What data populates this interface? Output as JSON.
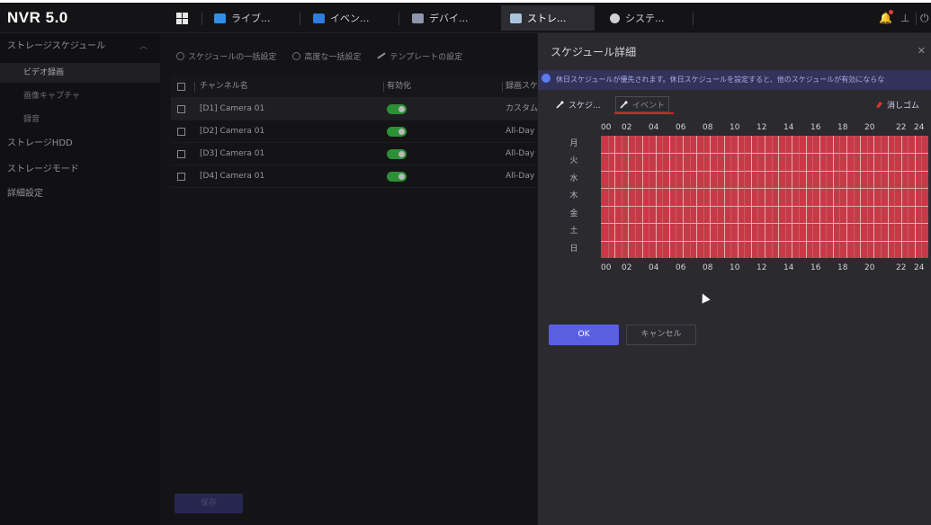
{
  "header": {
    "logo": "NVR 5.0",
    "tabs": [
      {
        "label": "ライブ...",
        "icon": "camera-icon"
      },
      {
        "label": "イベン...",
        "icon": "event-icon"
      },
      {
        "label": "デバイ...",
        "icon": "device-icon"
      },
      {
        "label": "ストレ...",
        "icon": "storage-icon"
      },
      {
        "label": "システ...",
        "icon": "system-gear-icon"
      }
    ],
    "active_tab": "ストレ...",
    "right_icons": [
      "notification-bell-icon",
      "export-icon",
      "power-icon"
    ]
  },
  "sidebar": {
    "section": "ストレージスケジュール",
    "items": [
      {
        "label": "ビデオ録画",
        "active": true
      },
      {
        "label": "画像キャプチャ"
      },
      {
        "label": "録音"
      }
    ],
    "groups": [
      "ストレージHDD",
      "ストレージモード",
      "詳細設定"
    ]
  },
  "toolbar": {
    "batch": "スケジュールの一括設定",
    "advanced_batch": "高度な一括設定",
    "template": "テンプレートの設定"
  },
  "table": {
    "headers": [
      "チャンネル名",
      "有効化",
      "録画スケ"
    ],
    "rows": [
      {
        "name": "[D1] Camera 01",
        "schedule": "カスタム"
      },
      {
        "name": "[D2] Camera 01",
        "schedule": "All-Day"
      },
      {
        "name": "[D3] Camera 01",
        "schedule": "All-Day"
      },
      {
        "name": "[D4] Camera 01",
        "schedule": "All-Day"
      }
    ]
  },
  "save_label": "保存",
  "panel": {
    "title": "スケジュール詳細",
    "notice": "休日スケジュールが優先されます。休日スケジュールを設定すると、他のスケジュールが有効にならな",
    "schedule_btn": "スケジ...",
    "event_btn": "イベント",
    "erase_btn": "消しゴム",
    "hours": [
      "00",
      "02",
      "04",
      "06",
      "08",
      "10",
      "12",
      "14",
      "16",
      "18",
      "20",
      "22",
      "24"
    ],
    "days": [
      "月",
      "火",
      "水",
      "木",
      "金",
      "土",
      "日"
    ],
    "ok": "OK",
    "cancel": "キャンセル",
    "grid_color": "#c63a48"
  }
}
